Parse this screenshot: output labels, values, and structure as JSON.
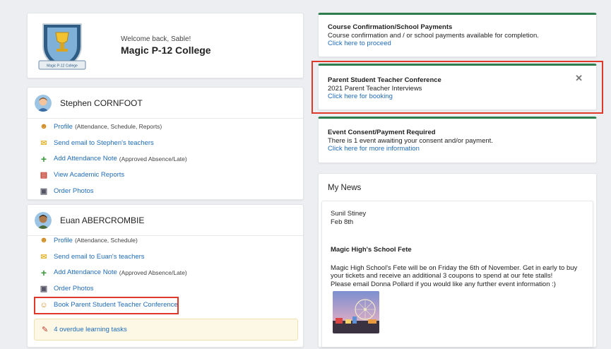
{
  "welcome": {
    "greeting": "Welcome back, Sable!",
    "school": "Magic P-12 College",
    "crest_text": "Magic P-12 College"
  },
  "students": [
    {
      "name": "Stephen CORNFOOT",
      "links": [
        {
          "label": "Profile",
          "note": "(Attendance, Schedule, Reports)",
          "icon": "user-icon"
        },
        {
          "label": "Send email to Stephen's teachers",
          "note": "",
          "icon": "envelope-icon"
        },
        {
          "label": "Add Attendance Note",
          "note": "(Approved Absence/Late)",
          "icon": "plus-icon"
        },
        {
          "label": "View Academic Reports",
          "note": "",
          "icon": "report-icon"
        },
        {
          "label": "Order Photos",
          "note": "",
          "icon": "camera-icon"
        }
      ]
    },
    {
      "name": "Euan ABERCROMBIE",
      "links": [
        {
          "label": "Profile",
          "note": "(Attendance, Schedule)",
          "icon": "user-icon"
        },
        {
          "label": "Send email to Euan's teachers",
          "note": "",
          "icon": "envelope-icon"
        },
        {
          "label": "Add Attendance Note",
          "note": "(Approved Absence/Late)",
          "icon": "plus-icon"
        },
        {
          "label": "Order Photos",
          "note": "",
          "icon": "camera-icon"
        },
        {
          "label": "Book Parent Student Teacher Conference",
          "note": "",
          "icon": "conference-icon"
        }
      ],
      "overdue": "4 overdue learning tasks"
    }
  ],
  "notices": [
    {
      "title": "Course Confirmation/School Payments",
      "text": "Course confirmation and / or school payments available for completion.",
      "link": "Click here to proceed"
    },
    {
      "title": "Parent Student Teacher Conference",
      "text": "2021 Parent Teacher Interviews",
      "link": "Click here for booking",
      "close": "✕"
    },
    {
      "title": "Event Consent/Payment Required",
      "text": "There is 1 event awaiting your consent and/or payment.",
      "link": "Click here for more information"
    }
  ],
  "news": {
    "title": "My News",
    "author": "Sunil Stiney",
    "date": "Feb 8th",
    "headline": "Magic High's School Fete",
    "body": "Magic High School's Fete will be on Friday the 6th of November. Get in early to buy your tickets and receive an additional 3 coupons to spend at our fete stalls!",
    "body2": "Please email Donna Pollard if you would like any further event information :)"
  },
  "colors": {
    "accent": "#2e7d4f",
    "link": "#1f6bb8",
    "highlight": "#e0382b"
  }
}
